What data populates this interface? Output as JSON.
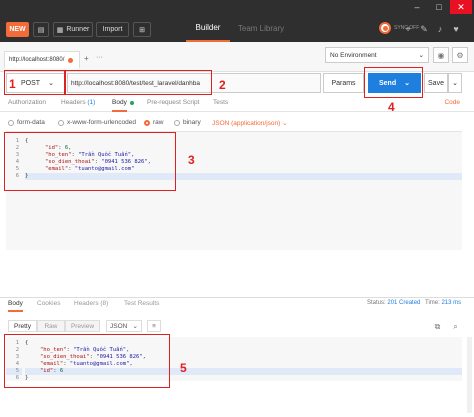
{
  "toolbar": {
    "new_label": "NEW",
    "runner_label": "Runner",
    "import_label": "Import",
    "builder_tab": "Builder",
    "team_library_tab": "Team Library",
    "sync_label": "SYNC OFF"
  },
  "tabs": {
    "request_tab_label": "http://localhost:8080/",
    "add_tab": "+",
    "more_tabs": "···"
  },
  "environment": {
    "selected": "No Environment"
  },
  "request": {
    "method": "POST",
    "url": "http://localhost:8080/test/test_laravel/danhba",
    "params_label": "Params",
    "send_label": "Send",
    "save_label": "Save",
    "code_label": "Code"
  },
  "request_tabs": [
    {
      "label": "Authorization"
    },
    {
      "label": "Headers",
      "count": "(1)"
    },
    {
      "label": "Body"
    },
    {
      "label": "Pre-request Script"
    },
    {
      "label": "Tests"
    }
  ],
  "body_types": [
    {
      "label": "form-data"
    },
    {
      "label": "x-www-form-urlencoded"
    },
    {
      "label": "raw"
    },
    {
      "label": "binary"
    }
  ],
  "content_type": "JSON (application/json)",
  "request_body_lines": [
    {
      "num": "1",
      "text": "{"
    },
    {
      "num": "2",
      "key": "\"id\"",
      "value": " 6,"
    },
    {
      "num": "3",
      "key": "\"ho_ten\"",
      "value": " \"Trần Quốc Tuấn\","
    },
    {
      "num": "4",
      "key": "\"so_dien_thoai\"",
      "value": " \"0941 536 826\","
    },
    {
      "num": "5",
      "key": "\"email\"",
      "value": " \"tuanto@gmail.com\""
    },
    {
      "num": "6",
      "text": "}"
    }
  ],
  "response": {
    "tabs": [
      {
        "label": "Body"
      },
      {
        "label": "Cookies"
      },
      {
        "label": "Headers",
        "count": "(8)"
      },
      {
        "label": "Test Results"
      }
    ],
    "status_label": "Status:",
    "status_value": "201 Created",
    "time_label": "Time:",
    "time_value": "213 ms",
    "formats": {
      "pretty": "Pretty",
      "raw": "Raw",
      "preview": "Preview",
      "json": "JSON"
    },
    "body_lines": [
      {
        "num": "1",
        "text": "{"
      },
      {
        "num": "2",
        "key": "\"ho_ten\"",
        "value": " \"Trần Quốc Tuấn\","
      },
      {
        "num": "3",
        "key": "\"so_dien_thoai\"",
        "value": " \"0941 536 826\","
      },
      {
        "num": "4",
        "key": "\"email\"",
        "value": " \"tuanto@gmail.com\","
      },
      {
        "num": "5",
        "key": "\"id\"",
        "value": " 6"
      },
      {
        "num": "6",
        "text": "}"
      }
    ]
  },
  "annotations": {
    "a1": "1",
    "a2": "2",
    "a3": "3",
    "a4": "4",
    "a5": "5"
  },
  "colors": {
    "accent": "#f26b3a",
    "send_button": "#1f7fde",
    "annotation": "#e02020"
  }
}
